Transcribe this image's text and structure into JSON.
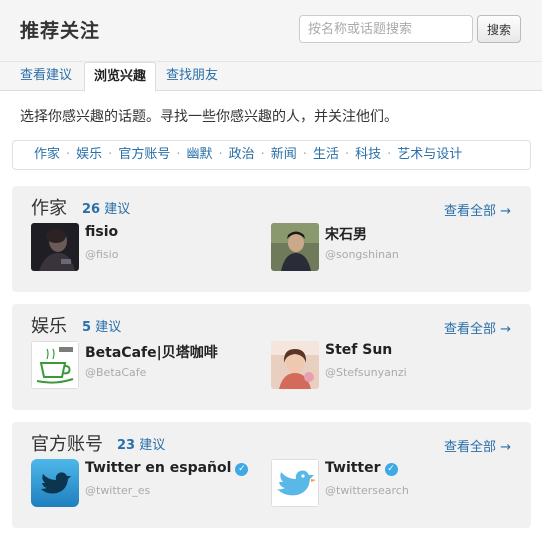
{
  "header": {
    "title": "推荐关注",
    "search_placeholder": "按名称或话题搜索",
    "search_button": "搜索"
  },
  "tabs": [
    {
      "label": "查看建议"
    },
    {
      "label": "浏览兴趣"
    },
    {
      "label": "查找朋友"
    }
  ],
  "intro": "选择你感兴趣的话题。寻找一些你感兴趣的人，并关注他们。",
  "categories": [
    "作家",
    "娱乐",
    "官方账号",
    "幽默",
    "政治",
    "新闻",
    "生活",
    "科技",
    "艺术与设计"
  ],
  "category_separator": "·",
  "sections": [
    {
      "title": "作家",
      "count": "26",
      "count_suffix": "建议",
      "view_all": "查看全部 →",
      "users": [
        {
          "name": "fisio",
          "handle": "@fisio",
          "verified": false
        },
        {
          "name": "宋石男",
          "handle": "@songshinan",
          "verified": false
        }
      ]
    },
    {
      "title": "娱乐",
      "count": "5",
      "count_suffix": "建议",
      "view_all": "查看全部 →",
      "users": [
        {
          "name": "BetaCafe|贝塔咖啡",
          "handle": "@BetaCafe",
          "verified": false
        },
        {
          "name": "Stef Sun",
          "handle": "@Stefsunyanzi",
          "verified": false
        }
      ]
    },
    {
      "title": "官方账号",
      "count": "23",
      "count_suffix": "建议",
      "view_all": "查看全部 →",
      "users": [
        {
          "name": "Twitter en español",
          "handle": "@twitter_es",
          "verified": true
        },
        {
          "name": "Twitter",
          "handle": "@twittersearch",
          "verified": true
        }
      ]
    }
  ],
  "colors": {
    "link": "#2a6fa8",
    "card_bg": "#f1f1f1",
    "verified": "#3ea9e5"
  }
}
